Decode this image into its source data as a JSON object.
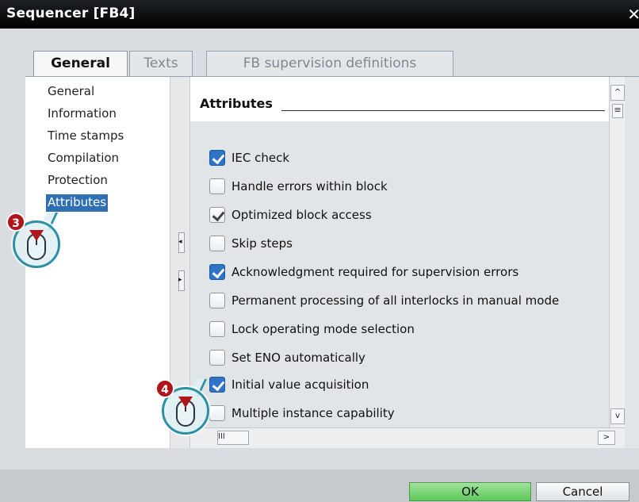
{
  "window": {
    "title": "Sequencer [FB4]",
    "close_glyph": "✕"
  },
  "tabs": [
    {
      "label": "General",
      "active": true
    },
    {
      "label": "Texts",
      "active": false
    },
    {
      "label": "FB supervision definitions",
      "active": false
    }
  ],
  "nav": {
    "items": [
      {
        "label": "General"
      },
      {
        "label": "Information"
      },
      {
        "label": "Time stamps"
      },
      {
        "label": "Compilation"
      },
      {
        "label": "Protection"
      },
      {
        "label": "Attributes",
        "selected": true
      }
    ]
  },
  "section": {
    "title": "Attributes"
  },
  "attributes": [
    {
      "label": "IEC check",
      "checked": true,
      "style": "blue"
    },
    {
      "label": "Handle errors within block",
      "checked": false
    },
    {
      "label": "Optimized block access",
      "checked": true,
      "style": "grey"
    },
    {
      "label": "Skip steps",
      "checked": false
    },
    {
      "label": "Acknowledgment required for supervision errors",
      "checked": true,
      "style": "blue"
    },
    {
      "label": "Permanent processing of all interlocks in manual mode",
      "checked": false
    },
    {
      "label": "Lock operating mode selection",
      "checked": false
    },
    {
      "label": "Set ENO automatically",
      "checked": false
    },
    {
      "label": "Initial value acquisition",
      "checked": true,
      "style": "blue"
    },
    {
      "label": "Multiple instance capability",
      "checked": false
    }
  ],
  "callouts": [
    {
      "number": "3",
      "icon": "mouse-click-icon"
    },
    {
      "number": "4",
      "icon": "mouse-click-icon"
    }
  ],
  "scroll": {
    "up_glyph": "^",
    "down_glyph": "v",
    "right_glyph": ">",
    "grip_glyph": "≡",
    "hgrip_glyph": "III",
    "split_left": "◂",
    "split_right": "▸"
  },
  "buttons": {
    "ok": "OK",
    "cancel": "Cancel"
  },
  "colors": {
    "accent": "#2f73c9",
    "selection": "#2f6fb2",
    "ok_button": "#5fc85b",
    "callout_ring": "#2c91a3",
    "callout_badge": "#b0151b"
  }
}
